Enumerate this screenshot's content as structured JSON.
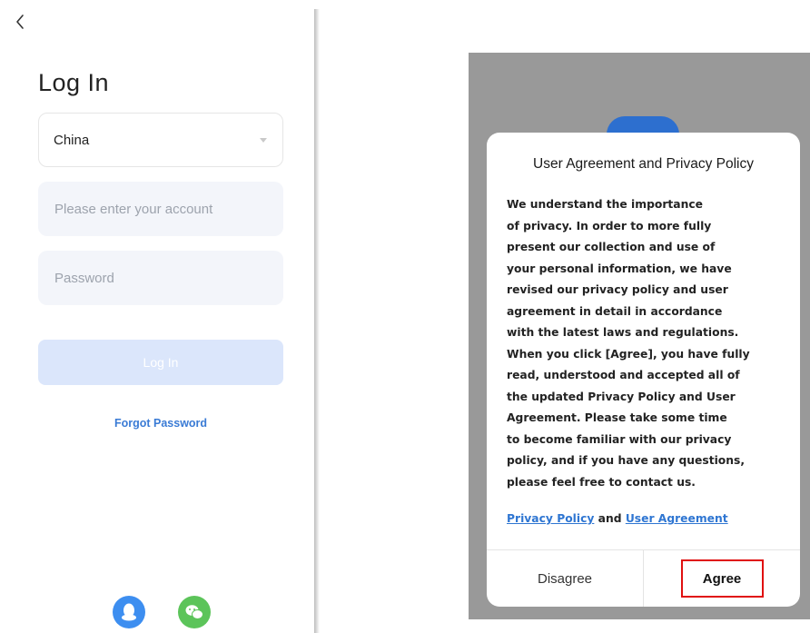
{
  "login": {
    "title": "Log In",
    "country": "China",
    "account_placeholder": "Please enter your account",
    "password_placeholder": "Password",
    "login_button": "Log In",
    "forgot_password": "Forgot Password"
  },
  "dialog": {
    "title": "User Agreement and Privacy Policy",
    "body_lines": [
      "We understand the importance",
      "of privacy. In order to more fully",
      "present our collection and use of",
      "your personal information, we have",
      "revised our privacy policy and user",
      "agreement in detail in accordance",
      "with the latest laws and regulations.",
      "When you click [Agree], you have fully",
      "read, understood and accepted all of",
      "the updated Privacy Policy and User",
      "Agreement. Please take some time",
      "to become familiar with our privacy",
      "policy, and if you have any questions,",
      "please feel free to contact us."
    ],
    "privacy_link": "Privacy Policy",
    "and_text": "and",
    "agreement_link": "User Agreement",
    "disagree_button": "Disagree",
    "agree_button": "Agree"
  },
  "colors": {
    "accent_blue": "#3a7bd5",
    "login_disabled": "#dbe6fb",
    "highlight_red": "#e01010",
    "qq_blue": "#3d8ef0",
    "wechat_green": "#5cc45a",
    "overlay_gray": "#999999"
  },
  "icons": {
    "back": "chevron-left-icon",
    "dropdown": "chevron-down-icon",
    "qq": "qq-penguin-icon",
    "wechat": "wechat-icon"
  }
}
